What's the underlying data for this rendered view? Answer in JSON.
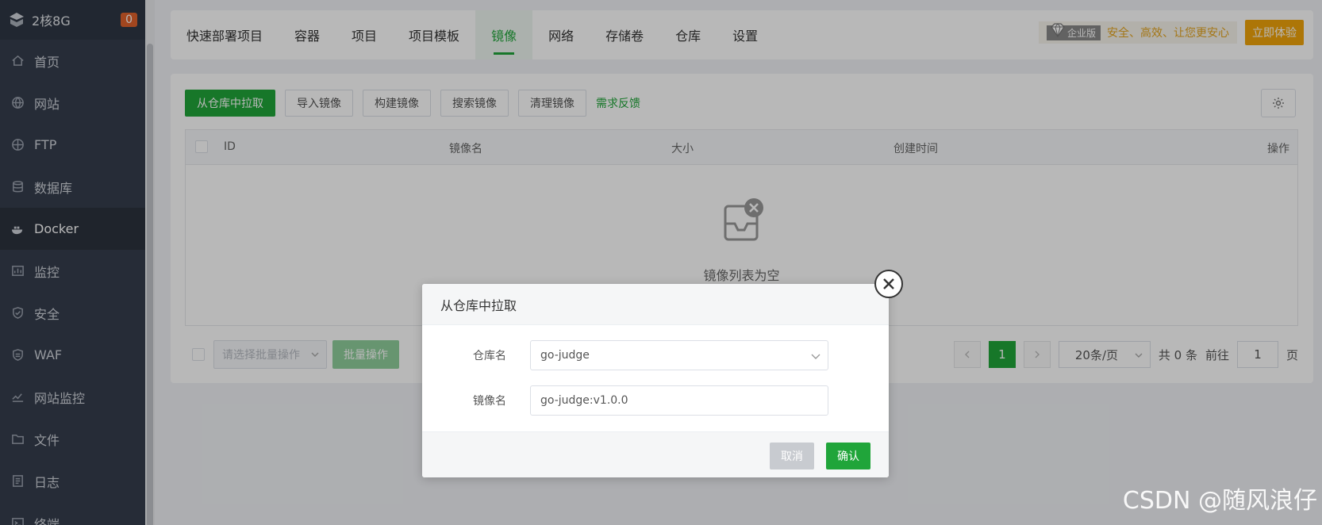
{
  "sidebar": {
    "host": "2核8G",
    "badge": "0",
    "items": [
      {
        "label": "首页",
        "icon": "home-icon"
      },
      {
        "label": "网站",
        "icon": "globe-icon"
      },
      {
        "label": "FTP",
        "icon": "ftp-globe-icon"
      },
      {
        "label": "数据库",
        "icon": "database-icon"
      },
      {
        "label": "Docker",
        "icon": "docker-icon"
      },
      {
        "label": "监控",
        "icon": "monitor-icon"
      },
      {
        "label": "安全",
        "icon": "shield-icon"
      },
      {
        "label": "WAF",
        "icon": "waf-shield-icon"
      },
      {
        "label": "网站监控",
        "icon": "chart-line-icon"
      },
      {
        "label": "文件",
        "icon": "folder-icon"
      },
      {
        "label": "日志",
        "icon": "log-icon"
      },
      {
        "label": "终端",
        "icon": "terminal-icon"
      }
    ]
  },
  "tabs": [
    "快速部署项目",
    "容器",
    "项目",
    "项目模板",
    "镜像",
    "网络",
    "存储卷",
    "仓库",
    "设置"
  ],
  "enterprise": {
    "tag": "企业版",
    "slogan": "安全、高效、让您更安心",
    "button": "立即体验"
  },
  "toolbar": {
    "pull": "从仓库中拉取",
    "import": "导入镜像",
    "build": "构建镜像",
    "search": "搜索镜像",
    "clean": "清理镜像",
    "feedback": "需求反馈"
  },
  "table": {
    "headers": {
      "id": "ID",
      "name": "镜像名",
      "size": "大小",
      "created": "创建时间",
      "ops": "操作"
    },
    "empty": "镜像列表为空"
  },
  "footer": {
    "batch_placeholder": "请选择批量操作",
    "batch_button": "批量操作",
    "page": "1",
    "per_page": "20条/页",
    "total": "共 0 条",
    "goto": "前往",
    "goto_value": "1",
    "page_suffix": "页"
  },
  "dialog": {
    "title": "从仓库中拉取",
    "repo_label": "仓库名",
    "repo_value": "go-judge",
    "image_label": "镜像名",
    "image_value": "go-judge:v1.0.0",
    "cancel": "取消",
    "confirm": "确认"
  },
  "watermark": "CSDN @随风浪仔"
}
